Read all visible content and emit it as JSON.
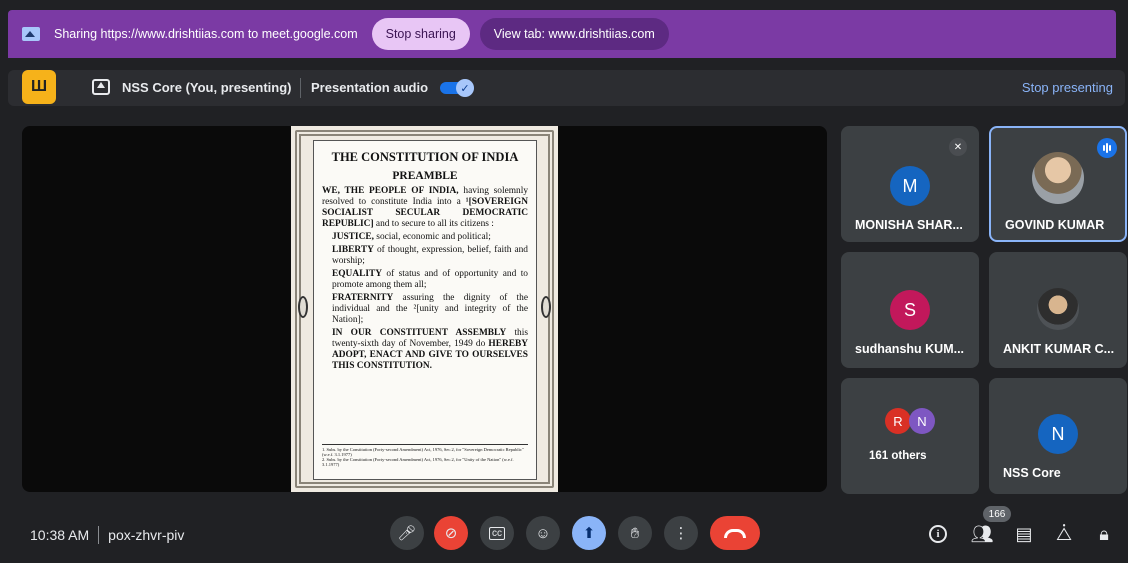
{
  "share_banner": {
    "text": "Sharing https://www.drishtiias.com to meet.google.com",
    "stop_label": "Stop sharing",
    "view_label": "View tab: www.drishtiias.com"
  },
  "present_bar": {
    "app_badge": "Ш",
    "name": "NSS Core (You, presenting)",
    "audio_label": "Presentation audio",
    "audio_on": true,
    "stop_label": "Stop presenting"
  },
  "document": {
    "title": "THE CONSTITUTION OF INDIA",
    "subtitle": "PREAMBLE",
    "p1_bold": "WE, THE PEOPLE OF INDIA,",
    "p1_rest": " having solemnly resolved to constitute India into a ",
    "p1_bold2": "¹[SOVEREIGN SOCIALIST SECULAR DEMOCRATIC REPUBLIC]",
    "p1_end": " and to secure to all its citizens :",
    "justice_b": "JUSTICE,",
    "justice_r": " social, economic and political;",
    "liberty_b": "LIBERTY",
    "liberty_r": " of thought, expression, belief, faith and worship;",
    "equality_b": "EQUALITY",
    "equality_r": " of status and of opportunity and to promote among them all;",
    "fraternity_b": "FRATERNITY",
    "fraternity_r": " assuring the dignity of the individual and the ²[unity and integrity of the Nation];",
    "assembly_b": "IN OUR CONSTITUENT ASSEMBLY",
    "assembly_r": " this twenty-sixth day of November, 1949 do ",
    "adopt_b": "HEREBY ADOPT, ENACT AND GIVE TO OURSELVES THIS CONSTITUTION.",
    "fn1": "1. Subs. by the Constitution (Forty-second Amendment) Act, 1976, Sec.2, for \"Sovereign Democratic Republic\" (w.e.f. 3.1.1977)",
    "fn2": "2. Subs. by the Constitution (Forty-second Amendment) Act, 1976, Sec.2, for \"Unity of the Nation\" (w.e.f. 3.1.1977)"
  },
  "participants": [
    {
      "name": "MONISHA SHAR...",
      "initial": "M",
      "color": "#1565c0",
      "muted": true
    },
    {
      "name": "GOVIND KUMAR",
      "initial": "",
      "speaking": true
    },
    {
      "name": "sudhanshu KUM...",
      "initial": "S",
      "color": "#c2185b"
    },
    {
      "name": "ANKIT KUMAR C...",
      "initial": ""
    },
    {
      "name": "161 others",
      "initials": [
        "R",
        "N"
      ],
      "colors": [
        "#d93025",
        "#7e57c2"
      ]
    },
    {
      "name": "NSS Core",
      "initial": "N",
      "color": "#1565c0"
    }
  ],
  "bottom": {
    "time": "10:38 AM",
    "meeting_code": "pox-zhvr-piv",
    "people_count": "166"
  }
}
